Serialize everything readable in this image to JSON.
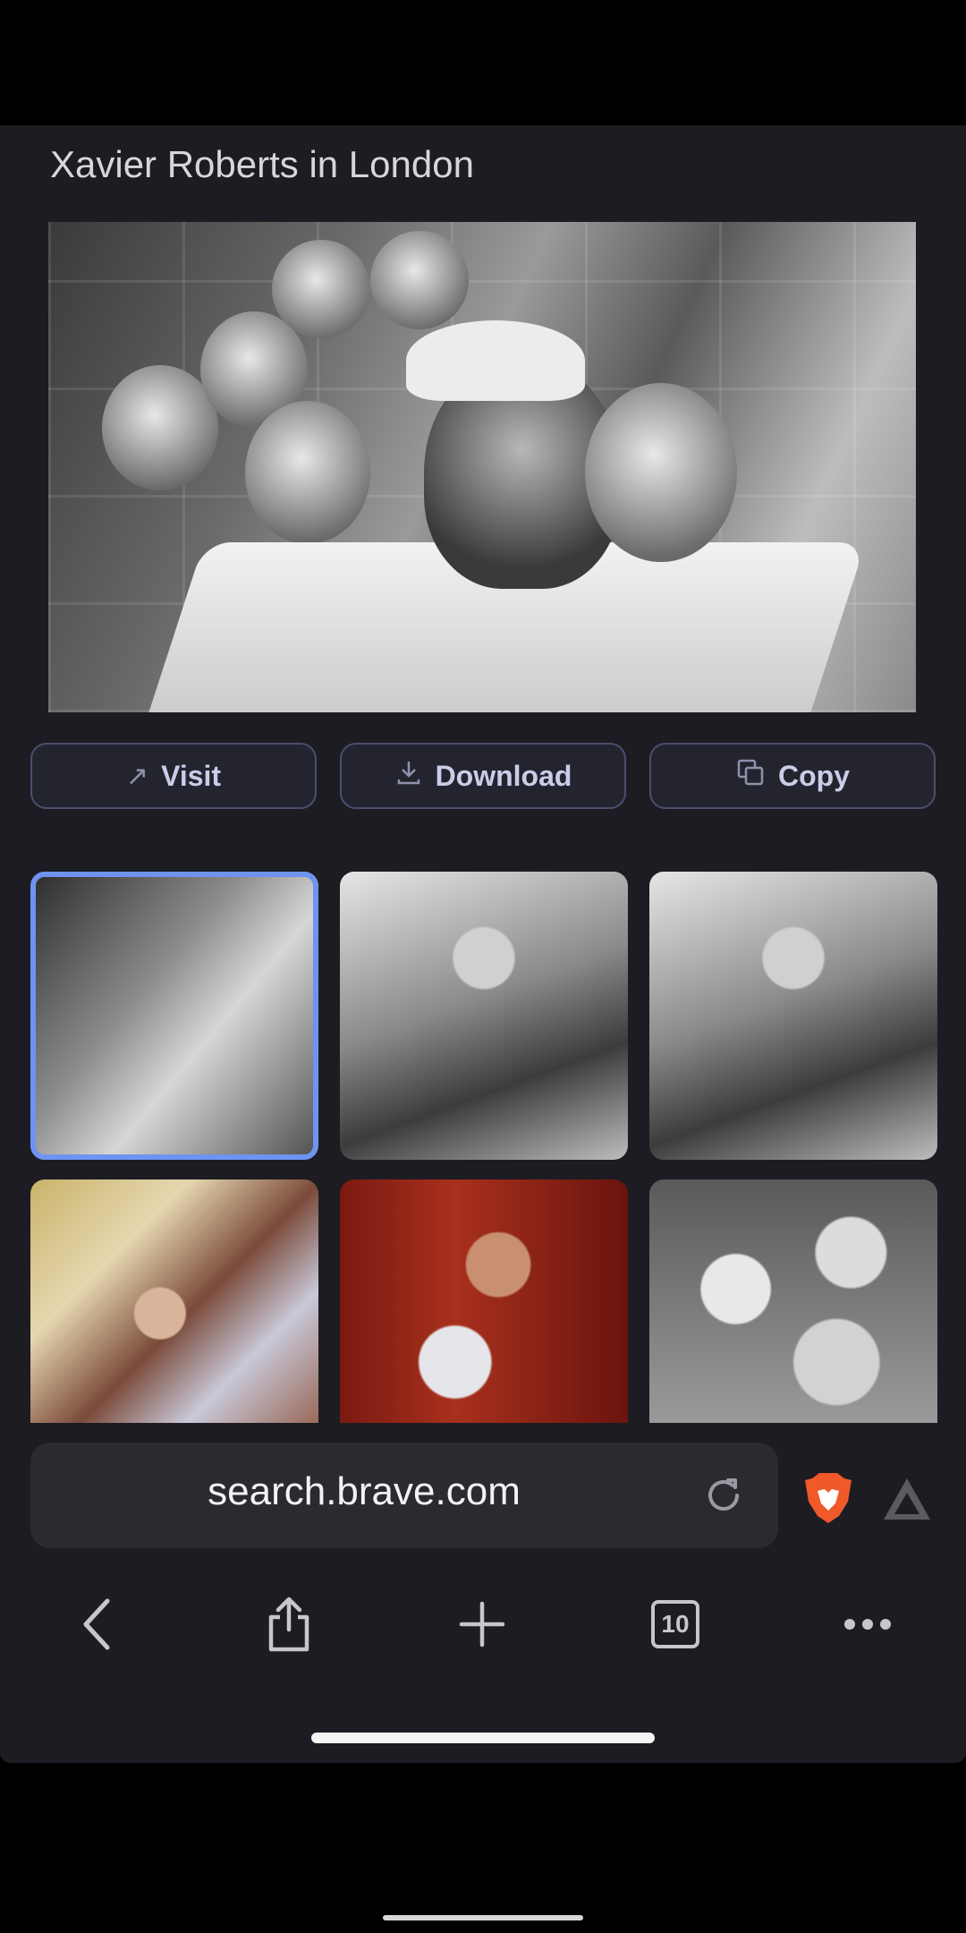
{
  "header": {
    "title": "Xavier Roberts in London"
  },
  "actions": {
    "visit": "Visit",
    "download": "Download",
    "copy": "Copy"
  },
  "thumbnails": [
    {
      "selected": true
    },
    {
      "selected": false
    },
    {
      "selected": false
    },
    {
      "selected": false
    },
    {
      "selected": false
    },
    {
      "selected": false
    }
  ],
  "address_bar": {
    "url": "search.brave.com"
  },
  "toolbar": {
    "tab_count": "10"
  },
  "colors": {
    "accent": "#6f93f0",
    "brave_orange": "#f0592a",
    "panel_bg": "#1c1c22"
  }
}
